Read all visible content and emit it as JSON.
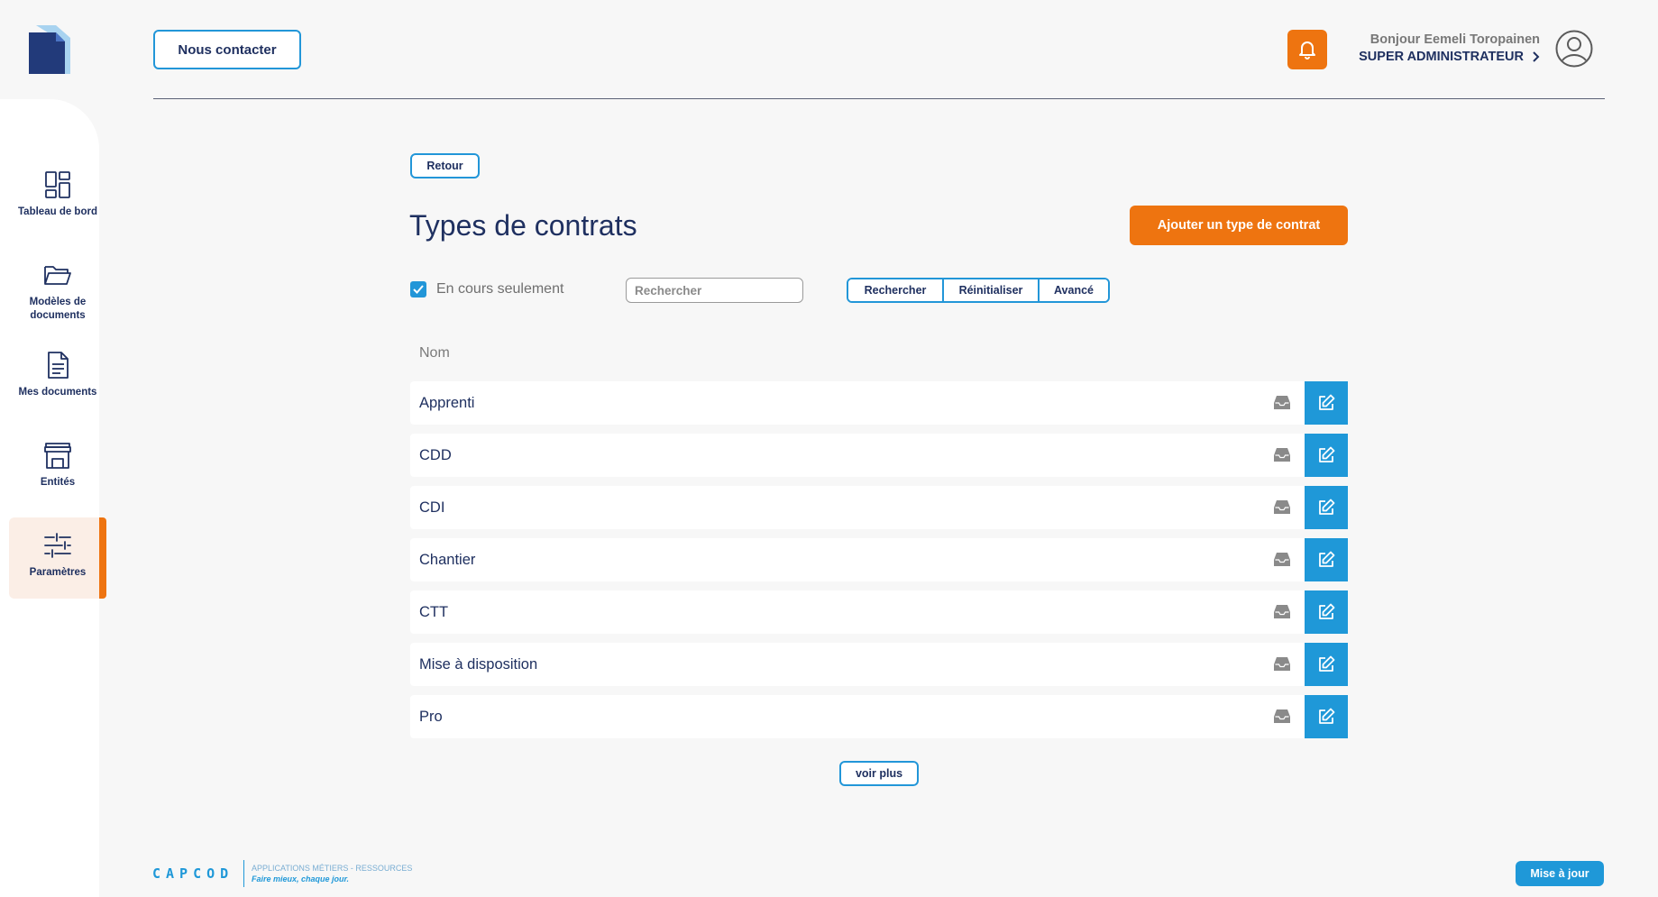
{
  "colors": {
    "primary": "#1f3060",
    "accent_orange": "#ee7410",
    "accent_blue": "#1f98d8",
    "background": "#f7f7f7"
  },
  "sidebar": {
    "items": [
      {
        "label": "Tableau de bord",
        "icon": "dashboard-icon",
        "active": false
      },
      {
        "label": "Modèles de documents",
        "icon": "folder-open-icon",
        "active": false
      },
      {
        "label": "Mes documents",
        "icon": "document-icon",
        "active": false
      },
      {
        "label": "Entités",
        "icon": "store-icon",
        "active": false
      },
      {
        "label": "Paramètres",
        "icon": "sliders-icon",
        "active": true
      }
    ]
  },
  "header": {
    "contact_label": "Nous contacter",
    "greeting": "Bonjour Eemeli Toropainen",
    "role": "SUPER ADMINISTRATEUR"
  },
  "main": {
    "back_label": "Retour",
    "title": "Types de contrats",
    "add_label": "Ajouter un type de contrat",
    "filters": {
      "current_only_label": "En cours seulement",
      "current_only_checked": true,
      "search_placeholder": "Rechercher",
      "search_value": "",
      "buttons": [
        "Rechercher",
        "Réinitialiser",
        "Avancé"
      ]
    },
    "column_header": "Nom",
    "rows": [
      "Apprenti",
      "CDD",
      "CDI",
      "Chantier",
      "CTT",
      "Mise à disposition",
      "Pro"
    ],
    "more_label": "voir plus"
  },
  "footer": {
    "brand": "CAPCOD",
    "tagline": "APPLICATIONS MÉTIERS - RESSOURCES",
    "slogan": "Faire mieux, chaque jour.",
    "update_label": "Mise à jour"
  }
}
